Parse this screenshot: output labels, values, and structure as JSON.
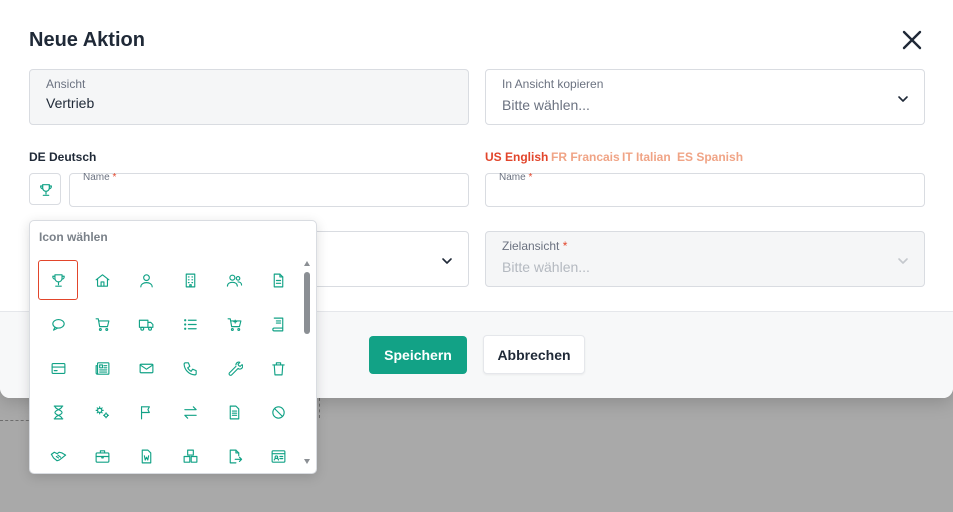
{
  "dialog": {
    "title": "Neue Aktion",
    "close_icon": "close-icon"
  },
  "ansicht": {
    "label": "Ansicht",
    "value": "Vertrieb"
  },
  "copy_view": {
    "label": "In Ansicht kopieren",
    "placeholder": "Bitte wählen..."
  },
  "left_section": {
    "title": "DE Deutsch",
    "name_label": "Name",
    "required_mark": "*"
  },
  "languages": [
    {
      "label": "US English",
      "active": true
    },
    {
      "label": "FR Francais",
      "active": false
    },
    {
      "label": "IT Italian",
      "active": false
    },
    {
      "label": "ES Spanish",
      "active": false
    }
  ],
  "right_name": {
    "label": "Name",
    "required_mark": "*"
  },
  "target_view": {
    "label": "Zielansicht",
    "required_mark": "*",
    "placeholder": "Bitte wählen..."
  },
  "footer": {
    "save_label": "Speichern",
    "cancel_label": "Abbrechen"
  },
  "icon_picker": {
    "title": "Icon wählen",
    "selected_icon": "trophy-icon",
    "icons": [
      "trophy-icon",
      "home-icon",
      "user-icon",
      "building-icon",
      "users-icon",
      "document-icon",
      "chat-bubble-icon",
      "cart-icon",
      "truck-icon",
      "list-icon",
      "cart-add-icon",
      "book-icon",
      "credit-card-icon",
      "newspaper-icon",
      "mail-icon",
      "phone-icon",
      "wrench-icon",
      "trash-icon",
      "hourglass-icon",
      "cogs-icon",
      "flag-icon",
      "arrows-swap-icon",
      "file-text-icon",
      "ban-icon",
      "handshake-icon",
      "briefcase-icon",
      "word-file-icon",
      "boxes-icon",
      "file-export-icon",
      "id-card-icon"
    ]
  },
  "colors": {
    "accent": "#12a286",
    "active_tab": "#e2452b",
    "inactive_tab": "#f0a486",
    "required": "#e2452b",
    "overlay": "#a9a9a9"
  }
}
